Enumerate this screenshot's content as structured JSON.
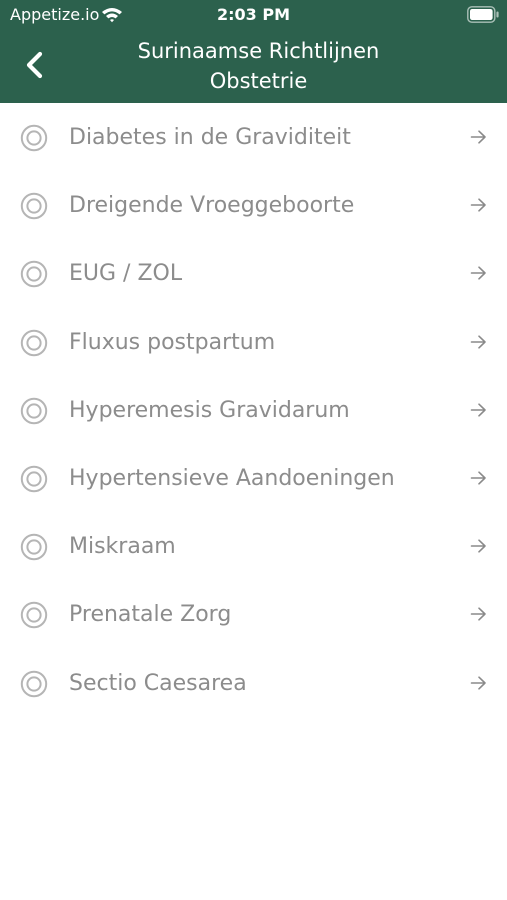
{
  "status_bar": {
    "carrier": "Appetize.io",
    "time": "2:03 PM",
    "wifi_icon": "wifi-icon",
    "battery_icon": "battery-icon"
  },
  "nav": {
    "title": "Surinaamse Richtlijnen\nObstetrie",
    "back_icon": "chevron-left-icon",
    "bar_color": "#2c614d"
  },
  "list": {
    "item_icon": "radio-circle-icon",
    "arrow_icon": "arrow-right-icon",
    "label_color": "#8c8c8c",
    "items": [
      {
        "label": "Diabetes in de Graviditeit"
      },
      {
        "label": "Dreigende Vroeggeboorte"
      },
      {
        "label": "EUG / ZOL"
      },
      {
        "label": "Fluxus postpartum"
      },
      {
        "label": "Hyperemesis Gravidarum"
      },
      {
        "label": "Hypertensieve Aandoeningen"
      },
      {
        "label": "Miskraam"
      },
      {
        "label": "Prenatale Zorg"
      },
      {
        "label": "Sectio Caesarea"
      }
    ]
  }
}
